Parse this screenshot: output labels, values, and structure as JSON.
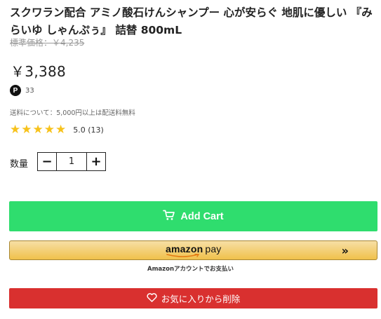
{
  "product": {
    "title": "スクワラン配合 アミノ酸石けんシャンプー 心が安らぐ 地肌に優しい 『みらいゆ しゃんぷぅ』 詰替 800mL",
    "list_price": "標準価格：￥4,235",
    "price": "￥3,388",
    "points_badge": "P",
    "points": "33",
    "shipping_note": "送料について：5,000円以上は配送料無料",
    "rating_value": 5.0,
    "rating_text": "5.0 (13)"
  },
  "quantity": {
    "label": "数量",
    "minus": "−",
    "value": "1",
    "plus": "+"
  },
  "actions": {
    "add_cart": "Add Cart",
    "amazon_logo": "amazon",
    "amazon_pay": "pay",
    "amazon_chevron": "»",
    "amazon_sub": "Amazonアカウントでお支払い",
    "remove_favorite": "お気に入りから削除"
  },
  "colors": {
    "star": "#f7c21b",
    "add_cart_bg": "#2fdd6e",
    "remove_bg": "#d9302f",
    "amazon_bg": "#f0c14b"
  },
  "icons": {
    "cart": "cart-icon",
    "heart": "heart-icon",
    "star": "star-icon"
  }
}
